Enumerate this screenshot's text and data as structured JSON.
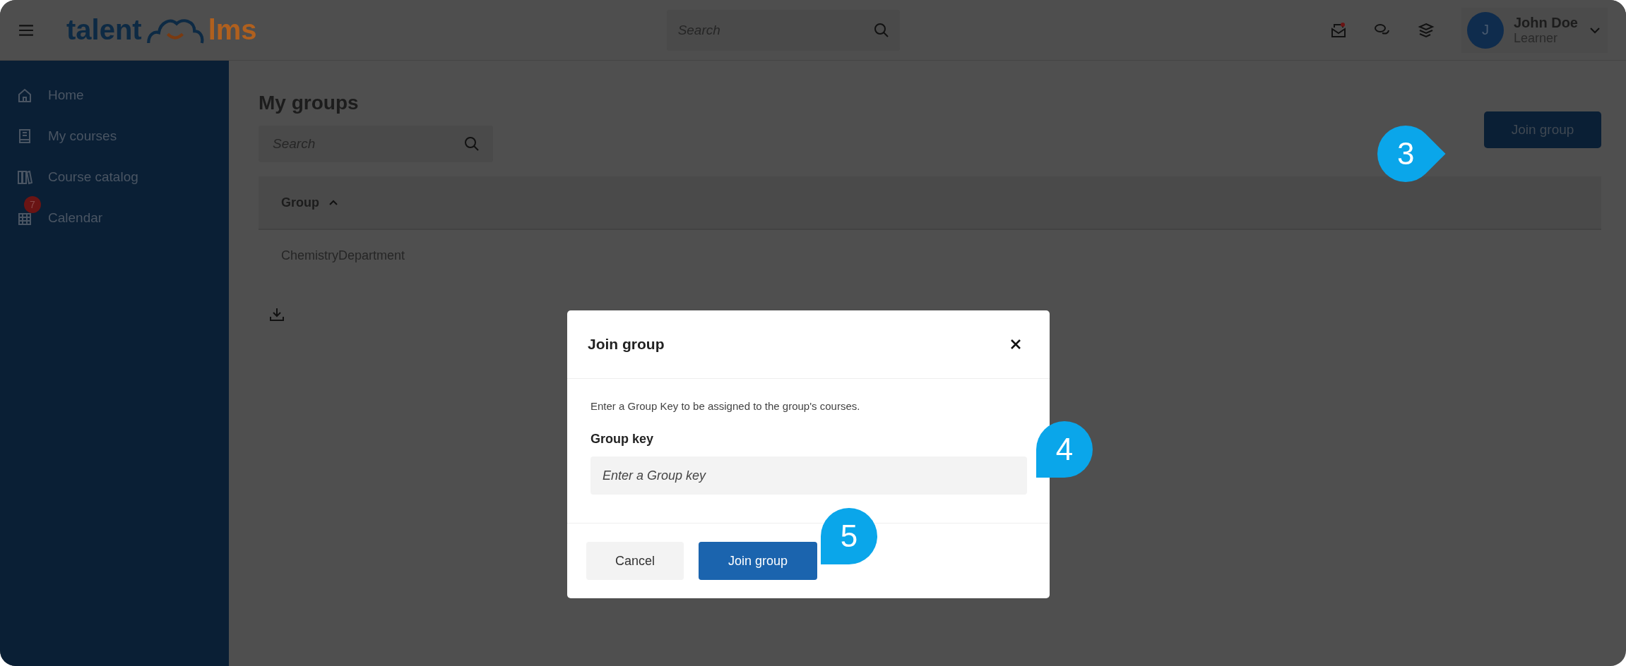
{
  "topbar": {
    "logo": {
      "first": "talent",
      "second": "lms"
    },
    "search": {
      "placeholder": "Search"
    },
    "user": {
      "initial": "J",
      "name": "John Doe",
      "role": "Learner"
    }
  },
  "sidebar": {
    "items": [
      {
        "kind": "home",
        "label": "Home"
      },
      {
        "kind": "courses",
        "label": "My courses"
      },
      {
        "kind": "catalog",
        "label": "Course catalog"
      },
      {
        "kind": "calendar",
        "label": "Calendar",
        "badge": "7"
      }
    ]
  },
  "page": {
    "title": "My groups",
    "search": {
      "placeholder": "Search"
    },
    "join_button": "Join group",
    "table": {
      "columns": [
        "Group"
      ],
      "rows": [
        "ChemistryDepartment"
      ]
    }
  },
  "modal": {
    "title": "Join group",
    "description": "Enter a Group Key to be assigned to the group's courses.",
    "field_label": "Group key",
    "placeholder": "Enter a Group key",
    "buttons": {
      "cancel": "Cancel",
      "confirm": "Join group"
    }
  },
  "callouts": [
    "3",
    "4",
    "5"
  ]
}
